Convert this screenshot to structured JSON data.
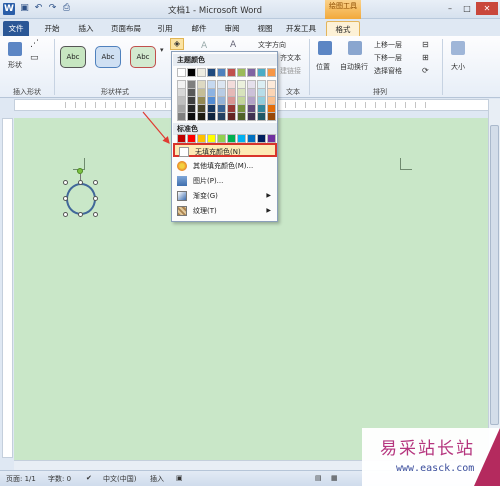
{
  "title_bar": {
    "logo": "W",
    "document_title": "文档1 - Microsoft Word",
    "context_tab_group": "绘图工具",
    "qat_icons": [
      "save-icon",
      "undo-icon",
      "redo-icon",
      "print-preview-icon"
    ],
    "controls": {
      "minimize": "–",
      "maximize": "□",
      "close": "✕"
    }
  },
  "tabs": [
    {
      "label": "文件",
      "type": "file"
    },
    {
      "label": "开始"
    },
    {
      "label": "插入"
    },
    {
      "label": "页面布局"
    },
    {
      "label": "引用"
    },
    {
      "label": "邮件"
    },
    {
      "label": "审阅"
    },
    {
      "label": "视图"
    },
    {
      "label": "开发工具"
    },
    {
      "label": "格式",
      "active": true
    }
  ],
  "ribbon": {
    "groups": [
      "插入形状",
      "形状样式",
      "文本",
      "排列",
      "大小"
    ],
    "shape_label": "形状",
    "style_buttons": [
      "Abc",
      "Abc",
      "Abc"
    ],
    "text_items": [
      "文字方向",
      "齐文本",
      "建链接"
    ],
    "arrange_items": [
      "位置",
      "自动换行",
      "上移一层",
      "下移一层",
      "选择窗格"
    ],
    "size_label": "大小"
  },
  "menu": {
    "theme_colors_label": "主题颜色",
    "standard_colors_label": "标准色",
    "theme_top_row": [
      "#ffffff",
      "#000000",
      "#eeece1",
      "#1f497d",
      "#4f81bd",
      "#c0504d",
      "#9bbb59",
      "#8064a2",
      "#4bacc6",
      "#f79646"
    ],
    "theme_shades": [
      [
        "#f2f2f2",
        "#7f7f7f",
        "#ddd9c3",
        "#c6d9f0",
        "#dbe5f1",
        "#f2dcdb",
        "#ebf1dd",
        "#e5e0ec",
        "#dbeef3",
        "#fdeada"
      ],
      [
        "#d8d8d8",
        "#595959",
        "#c4bd97",
        "#8db3e2",
        "#b8cce4",
        "#e5b9b7",
        "#d7e3bc",
        "#ccc1d9",
        "#b7dde8",
        "#fbd5b5"
      ],
      [
        "#bfbfbf",
        "#3f3f3f",
        "#938953",
        "#548dd4",
        "#95b3d7",
        "#d99694",
        "#c3d69b",
        "#b2a2c7",
        "#92cddc",
        "#fac08f"
      ],
      [
        "#a5a5a5",
        "#262626",
        "#494429",
        "#17365d",
        "#366092",
        "#953734",
        "#76923c",
        "#5f497a",
        "#31859b",
        "#e36c09"
      ],
      [
        "#7f7f7f",
        "#0c0c0c",
        "#1d1b10",
        "#0f243e",
        "#244061",
        "#632423",
        "#4f6128",
        "#3f3151",
        "#205867",
        "#974806"
      ]
    ],
    "standard_colors": [
      "#c00000",
      "#ff0000",
      "#ffc000",
      "#ffff00",
      "#92d050",
      "#00b050",
      "#00b0f0",
      "#0070c0",
      "#002060",
      "#7030a0"
    ],
    "items": [
      {
        "label": "无填充颜色(N)",
        "icon": "no-fill-icon",
        "highlight": true
      },
      {
        "label": "其他填充颜色(M)...",
        "icon": "color-wheel-icon"
      },
      {
        "label": "图片(P)...",
        "icon": "picture-icon"
      },
      {
        "label": "渐变(G)",
        "icon": "gradient-icon",
        "submenu": true
      },
      {
        "label": "纹理(T)",
        "icon": "texture-icon",
        "submenu": true
      }
    ]
  },
  "status_bar": {
    "page": "页面: 1/1",
    "words": "字数: 0",
    "language": "中文(中国)",
    "mode": "插入"
  },
  "watermark": {
    "name": "易采站长站",
    "url": "www.easck.com"
  },
  "colors": {
    "document_bg": "#c9e7c8",
    "highlight_border": "#d9342b",
    "file_tab": "#2b5796"
  }
}
